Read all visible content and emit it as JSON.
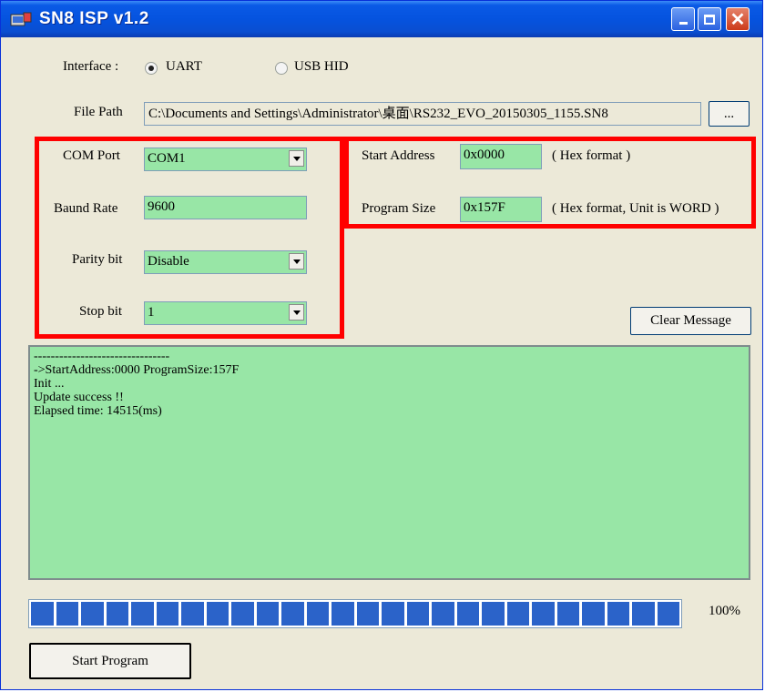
{
  "window": {
    "title": "SN8 ISP  v1.2",
    "buttons": {
      "minimize": "_",
      "maximize": "□",
      "close": "✕"
    }
  },
  "interface": {
    "label": "Interface :",
    "options": [
      "UART",
      "USB HID"
    ],
    "selected": "UART"
  },
  "file": {
    "label": "File Path",
    "value": "C:\\Documents and Settings\\Administrator\\桌面\\RS232_EVO_20150305_1155.SN8",
    "browse_label": "..."
  },
  "serial": {
    "com_port_label": "COM Port",
    "com_port_value": "COM1",
    "baud_label": "Baund Rate",
    "baud_value": "9600",
    "parity_label": "Parity bit",
    "parity_value": "Disable",
    "stop_label": "Stop bit",
    "stop_value": "1"
  },
  "program": {
    "start_label": "Start Address",
    "start_value": "0x0000",
    "start_hint": "( Hex format )",
    "size_label": "Program Size",
    "size_value": "0x157F",
    "size_hint": "( Hex format, Unit is WORD )"
  },
  "actions": {
    "clear_message": "Clear Message",
    "start_program": "Start Program"
  },
  "messages": [
    "--------------------------------",
    "->StartAddress:0000 ProgramSize:157F",
    "Init ...",
    "Update success !!",
    "Elapsed time: 14515(ms)"
  ],
  "progress": {
    "percent_text": "100%",
    "fraction": 1.0
  },
  "colors": {
    "field_green": "#98e6a6",
    "highlight_red": "#ff0000",
    "progress_blue": "#2b63c9",
    "titlebar_blue": "#0553df"
  }
}
